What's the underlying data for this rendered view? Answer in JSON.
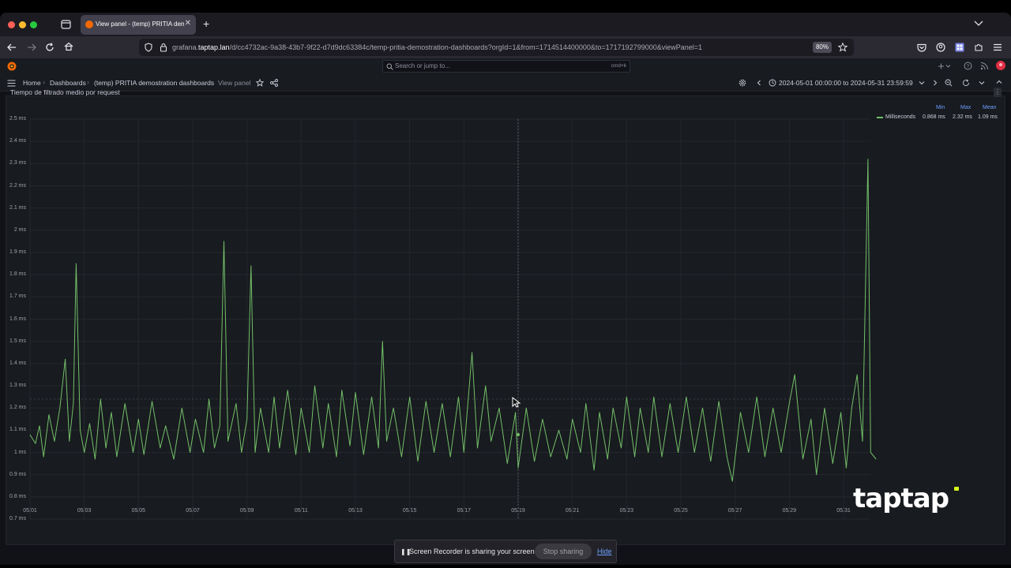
{
  "browser": {
    "tab_title": "View panel - (temp) PRITIA demostration dashboards",
    "url_prefix": "grafana.",
    "url_host": "taptap.lan",
    "url_path": "/d/cc4732ac-9a38-43b7-9f22-d7d9dc63384c/temp-pritia-demostration-dashboards?orgId=1&from=1714514400000&to=1717192799000&viewPanel=1",
    "zoom": "80%"
  },
  "grafana": {
    "search_placeholder": "Search or jump to...",
    "search_shortcut": "cmd+k",
    "breadcrumbs": [
      "Home",
      "Dashboards",
      "(temp) PRITIA demostration dashboards",
      "View panel"
    ],
    "time_range": "2024-05-01 00:00:00 to 2024-05-31 23:59:59"
  },
  "panel": {
    "title": "Tiempo de filtrado medio por request",
    "legend": {
      "headers": [
        "Min",
        "Max",
        "Mean"
      ],
      "series_name": "Milliseconds",
      "min": "0.868 ms",
      "max": "2.32 ms",
      "mean": "1.09 ms",
      "color": "#73bf69"
    }
  },
  "chart_data": {
    "type": "line",
    "title": "Tiempo de filtrado medio por request",
    "y_ticks": [
      "0.7 ms",
      "0.8 ms",
      "0.9 ms",
      "1 ms",
      "1.1 ms",
      "1.2 ms",
      "1.3 ms",
      "1.4 ms",
      "1.5 ms",
      "1.6 ms",
      "1.7 ms",
      "1.8 ms",
      "1.9 ms",
      "2 ms",
      "2.1 ms",
      "2.2 ms",
      "2.3 ms",
      "2.4 ms",
      "2.5 ms"
    ],
    "x_ticks": [
      "05/01",
      "05/03",
      "05/05",
      "05/07",
      "05/09",
      "05/11",
      "05/13",
      "05/15",
      "05/17",
      "05/19",
      "05/21",
      "05/23",
      "05/25",
      "05/27",
      "05/29",
      "05/31"
    ],
    "ylim": [
      0.7,
      2.5
    ],
    "xlim": [
      0,
      30.99
    ],
    "x_unit": "days since 05/01 00:00",
    "series": [
      {
        "name": "Milliseconds",
        "color": "#73bf69",
        "points": [
          [
            0,
            1.08
          ],
          [
            0.2,
            1.04
          ],
          [
            0.35,
            1.12
          ],
          [
            0.5,
            0.98
          ],
          [
            0.7,
            1.17
          ],
          [
            0.9,
            1.05
          ],
          [
            1.1,
            1.2
          ],
          [
            1.3,
            1.42
          ],
          [
            1.45,
            1.05
          ],
          [
            1.6,
            1.22
          ],
          [
            1.7,
            1.85
          ],
          [
            1.85,
            1.1
          ],
          [
            2.0,
            1.0
          ],
          [
            2.2,
            1.13
          ],
          [
            2.4,
            0.97
          ],
          [
            2.6,
            1.24
          ],
          [
            2.8,
            1.02
          ],
          [
            3.0,
            1.18
          ],
          [
            3.2,
            0.98
          ],
          [
            3.5,
            1.22
          ],
          [
            3.8,
            1.0
          ],
          [
            4.0,
            1.15
          ],
          [
            4.2,
            0.99
          ],
          [
            4.5,
            1.23
          ],
          [
            4.8,
            1.02
          ],
          [
            5.0,
            1.12
          ],
          [
            5.3,
            0.97
          ],
          [
            5.6,
            1.2
          ],
          [
            5.9,
            1.0
          ],
          [
            6.1,
            1.15
          ],
          [
            6.4,
            1.0
          ],
          [
            6.6,
            1.24
          ],
          [
            6.8,
            1.02
          ],
          [
            7.0,
            1.12
          ],
          [
            7.15,
            1.95
          ],
          [
            7.3,
            1.05
          ],
          [
            7.6,
            1.22
          ],
          [
            7.8,
            1.0
          ],
          [
            8.0,
            1.15
          ],
          [
            8.15,
            1.84
          ],
          [
            8.3,
            1.0
          ],
          [
            8.5,
            1.2
          ],
          [
            8.8,
            1.0
          ],
          [
            9.0,
            1.25
          ],
          [
            9.2,
            1.02
          ],
          [
            9.5,
            1.28
          ],
          [
            9.8,
            0.99
          ],
          [
            10.0,
            1.2
          ],
          [
            10.3,
            1.0
          ],
          [
            10.5,
            1.3
          ],
          [
            10.8,
            1.02
          ],
          [
            11.0,
            1.22
          ],
          [
            11.3,
            0.98
          ],
          [
            11.5,
            1.28
          ],
          [
            11.8,
            1.03
          ],
          [
            12.0,
            1.27
          ],
          [
            12.3,
            0.99
          ],
          [
            12.6,
            1.25
          ],
          [
            12.85,
            1.02
          ],
          [
            13.0,
            1.5
          ],
          [
            13.15,
            1.05
          ],
          [
            13.4,
            1.2
          ],
          [
            13.7,
            0.98
          ],
          [
            14.0,
            1.25
          ],
          [
            14.3,
            0.96
          ],
          [
            14.6,
            1.23
          ],
          [
            14.9,
            1.0
          ],
          [
            15.2,
            1.22
          ],
          [
            15.5,
            0.98
          ],
          [
            15.8,
            1.25
          ],
          [
            16.0,
            1.0
          ],
          [
            16.3,
            1.45
          ],
          [
            16.5,
            1.02
          ],
          [
            16.8,
            1.3
          ],
          [
            17.0,
            1.05
          ],
          [
            17.3,
            1.2
          ],
          [
            17.6,
            0.95
          ],
          [
            17.9,
            1.18
          ],
          [
            18.0,
            0.93
          ],
          [
            18.3,
            1.2
          ],
          [
            18.6,
            0.96
          ],
          [
            18.9,
            1.15
          ],
          [
            19.2,
            0.98
          ],
          [
            19.5,
            1.1
          ],
          [
            19.8,
            0.97
          ],
          [
            20.0,
            1.15
          ],
          [
            20.3,
            1.0
          ],
          [
            20.5,
            1.22
          ],
          [
            20.8,
            0.92
          ],
          [
            21.0,
            1.18
          ],
          [
            21.3,
            0.97
          ],
          [
            21.5,
            1.2
          ],
          [
            21.8,
            1.02
          ],
          [
            22.0,
            1.25
          ],
          [
            22.3,
            0.98
          ],
          [
            22.5,
            1.2
          ],
          [
            22.8,
            1.0
          ],
          [
            23.0,
            1.25
          ],
          [
            23.3,
            0.98
          ],
          [
            23.6,
            1.22
          ],
          [
            23.9,
            1.0
          ],
          [
            24.2,
            1.25
          ],
          [
            24.5,
            1.0
          ],
          [
            24.8,
            1.2
          ],
          [
            25.1,
            0.96
          ],
          [
            25.4,
            1.23
          ],
          [
            25.7,
            0.98
          ],
          [
            25.9,
            0.87
          ],
          [
            26.2,
            1.18
          ],
          [
            26.5,
            1.0
          ],
          [
            26.8,
            1.25
          ],
          [
            27.1,
            0.98
          ],
          [
            27.4,
            1.2
          ],
          [
            27.7,
            1.0
          ],
          [
            28.0,
            1.22
          ],
          [
            28.2,
            1.35
          ],
          [
            28.5,
            0.97
          ],
          [
            28.8,
            1.15
          ],
          [
            29.0,
            0.9
          ],
          [
            29.3,
            1.2
          ],
          [
            29.6,
            0.95
          ],
          [
            29.9,
            1.18
          ],
          [
            30.1,
            0.93
          ],
          [
            30.3,
            1.2
          ],
          [
            30.5,
            1.35
          ],
          [
            30.7,
            1.05
          ],
          [
            30.9,
            2.32
          ],
          [
            31.0,
            1.0
          ],
          [
            31.2,
            0.97
          ]
        ]
      }
    ]
  },
  "watermark": "taptap",
  "share_bar": {
    "message": "Screen Recorder is sharing your screen.",
    "stop_label": "Stop sharing",
    "hide_label": "Hide"
  }
}
